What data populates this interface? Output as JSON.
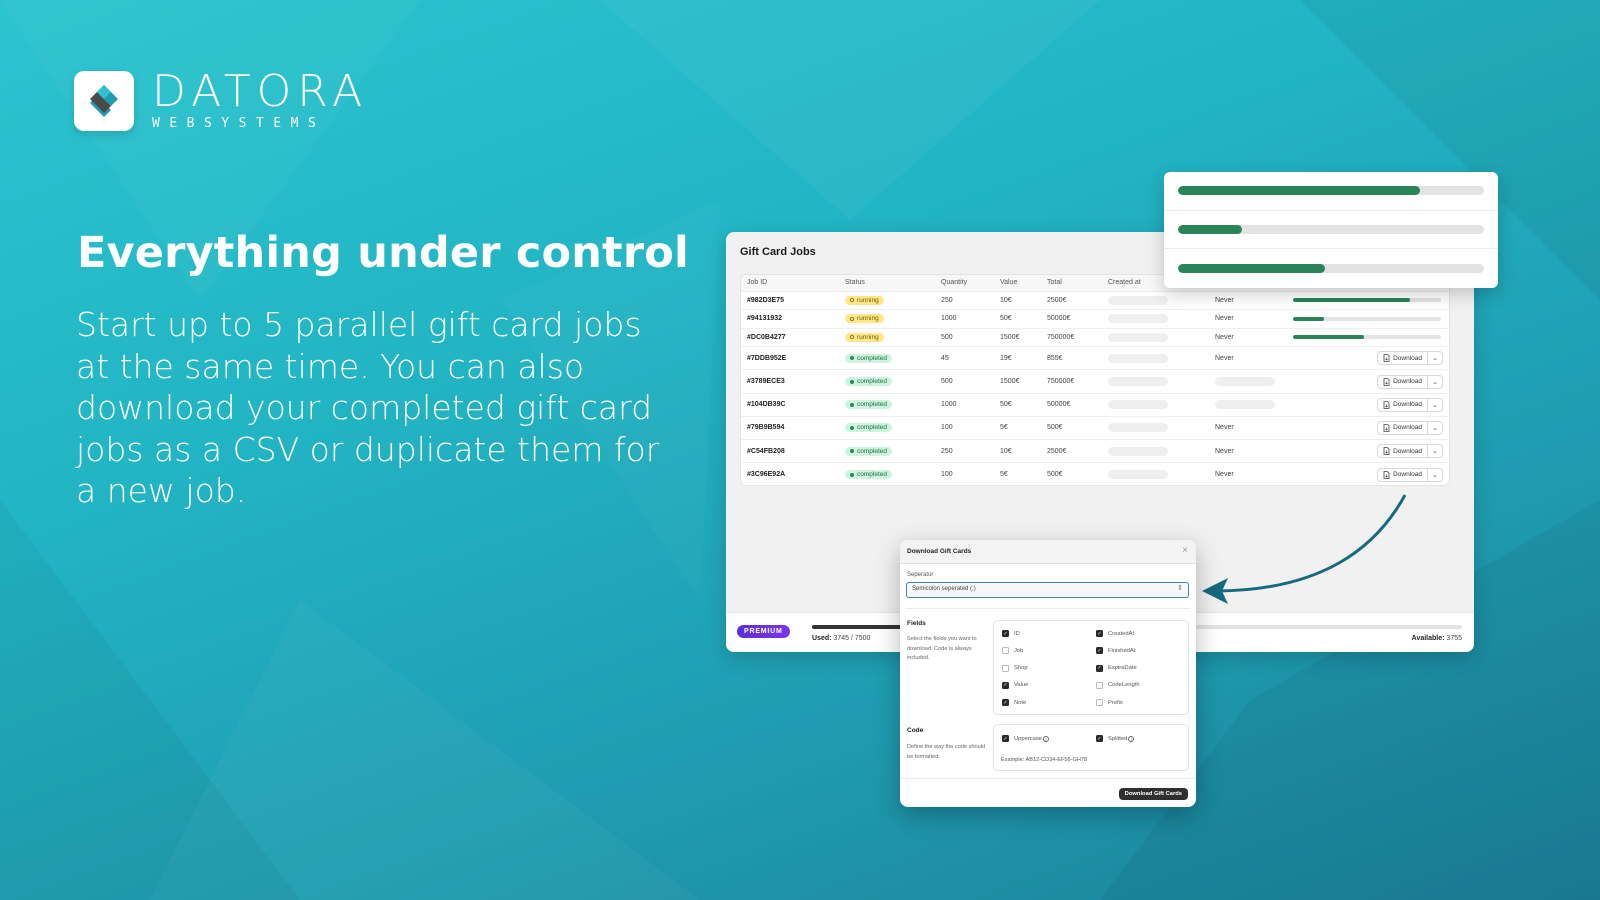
{
  "brand": {
    "name": "DATORA",
    "subtitle": "WEBSYSTEMS",
    "accent_color": "#22b5c4"
  },
  "headline": "Everything under control",
  "body_copy": "Start up to 5 parallel gift card jobs at the same time. You can also download your completed gift card jobs as a CSV or duplicate them for a new job.",
  "panel": {
    "title": "Gift Card Jobs",
    "columns": [
      "Job ID",
      "Status",
      "Quantity",
      "Value",
      "Total",
      "Created at",
      "",
      ""
    ],
    "rows": [
      {
        "id": "#982D3E75",
        "status": "running",
        "quantity": "250",
        "value": "10€",
        "total": "2500€",
        "finished": "Never",
        "progress": 0.79
      },
      {
        "id": "#94131932",
        "status": "running",
        "quantity": "1000",
        "value": "50€",
        "total": "50000€",
        "finished": "Never",
        "progress": 0.21
      },
      {
        "id": "#DC0B4277",
        "status": "running",
        "quantity": "500",
        "value": "1500€",
        "total": "750000€",
        "finished": "Never",
        "progress": 0.48
      },
      {
        "id": "#7DDB952E",
        "status": "completed",
        "quantity": "45",
        "value": "19€",
        "total": "855€",
        "finished": "Never",
        "action": "Download"
      },
      {
        "id": "#3789ECE3",
        "status": "completed",
        "quantity": "500",
        "value": "1500€",
        "total": "750000€",
        "finished": "",
        "action": "Download"
      },
      {
        "id": "#104DB39C",
        "status": "completed",
        "quantity": "1000",
        "value": "50€",
        "total": "50000€",
        "finished": "",
        "action": "Download"
      },
      {
        "id": "#79B9B594",
        "status": "completed",
        "quantity": "100",
        "value": "5€",
        "total": "500€",
        "finished": "Never",
        "action": "Download"
      },
      {
        "id": "#C54FB208",
        "status": "completed",
        "quantity": "250",
        "value": "10€",
        "total": "2500€",
        "finished": "Never",
        "action": "Download"
      },
      {
        "id": "#3C96E92A",
        "status": "completed",
        "quantity": "100",
        "value": "5€",
        "total": "500€",
        "finished": "Never",
        "action": "Download"
      }
    ],
    "footer": {
      "plan": "PREMIUM",
      "used_label": "Used:",
      "used_value": "3745 / 7500",
      "usage_fraction": 0.4993,
      "available_label": "Available:",
      "available_value": "3755"
    }
  },
  "progress_popup": {
    "bars": [
      0.79,
      0.21,
      0.48
    ],
    "color": "#2a8458"
  },
  "modal": {
    "title": "Download Gift Cards",
    "close_icon": "close-icon",
    "separator_label": "Seperator",
    "separator_value": "Semicolon seperated (;)",
    "fields_title": "Fields",
    "fields_desc": "Select the fields you want to download. Code is always included.",
    "fields": [
      {
        "label": "ID",
        "checked": true
      },
      {
        "label": "CreatedAt",
        "checked": true
      },
      {
        "label": "Job",
        "checked": false
      },
      {
        "label": "FinishedAt",
        "checked": true
      },
      {
        "label": "Shop",
        "checked": false
      },
      {
        "label": "ExpireDate",
        "checked": true
      },
      {
        "label": "Value",
        "checked": true
      },
      {
        "label": "CodeLength",
        "checked": false
      },
      {
        "label": "Note",
        "checked": true
      },
      {
        "label": "Prefix",
        "checked": false
      }
    ],
    "code_title": "Code",
    "code_desc": "Define the way the code should be formatted.",
    "code_options": [
      {
        "label": "Uppercase",
        "checked": true
      },
      {
        "label": "Splitted",
        "checked": true
      }
    ],
    "code_example": "Example: AB12-CD34-EF56-GH78",
    "submit_label": "Download Gift Cards"
  }
}
